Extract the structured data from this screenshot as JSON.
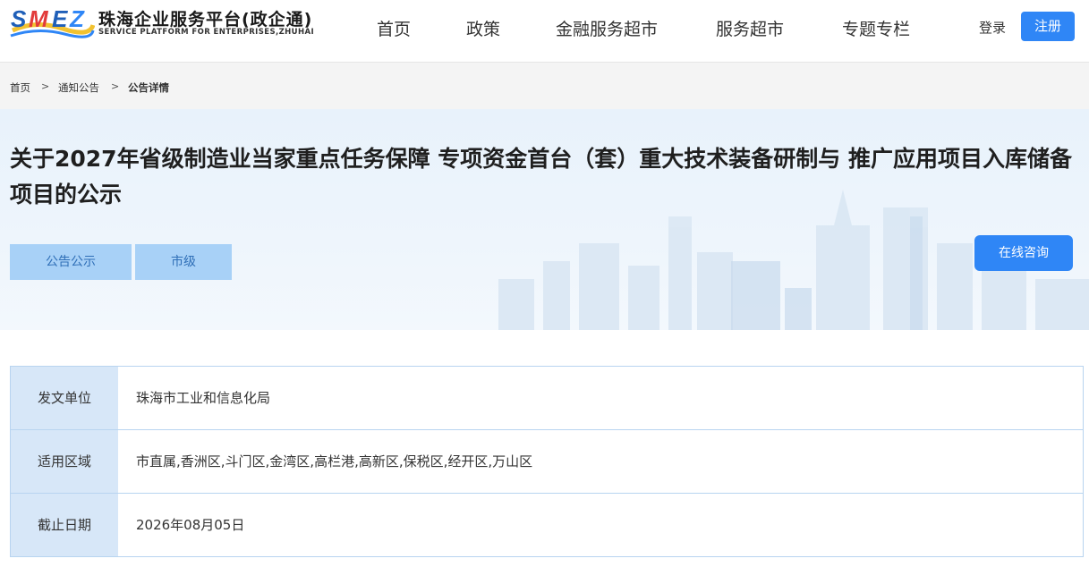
{
  "header": {
    "logo_mark": "SMEZ",
    "logo_cn": "珠海企业服务平台(政企通)",
    "logo_en": "SERVICE PLATFORM FOR ENTERPRISES,ZHUHAI",
    "nav": [
      "首页",
      "政策",
      "金融服务超市",
      "服务超市",
      "专题专栏"
    ],
    "login_label": "登录",
    "register_label": "注册"
  },
  "breadcrumb": {
    "items": [
      "首页",
      "通知公告",
      "公告详情"
    ],
    "separator": ">"
  },
  "banner": {
    "title": "关于2027年省级制造业当家重点任务保障 专项资金首台（套）重大技术装备研制与 推广应用项目入库储备项目的公示",
    "tags": [
      "公告公示",
      "市级"
    ],
    "consult_label": "在线咨询"
  },
  "info": {
    "rows": [
      {
        "label": "发文单位",
        "value": "珠海市工业和信息化局"
      },
      {
        "label": "适用区域",
        "value": "市直属,香洲区,斗门区,金湾区,高栏港,高新区,保税区,经开区,万山区"
      },
      {
        "label": "截止日期",
        "value": "2026年08月05日"
      }
    ]
  },
  "colors": {
    "primary": "#2f86f6",
    "tag_bg": "#a8d1f7",
    "label_bg": "#d7e7f8",
    "border": "#b8d4f0"
  }
}
